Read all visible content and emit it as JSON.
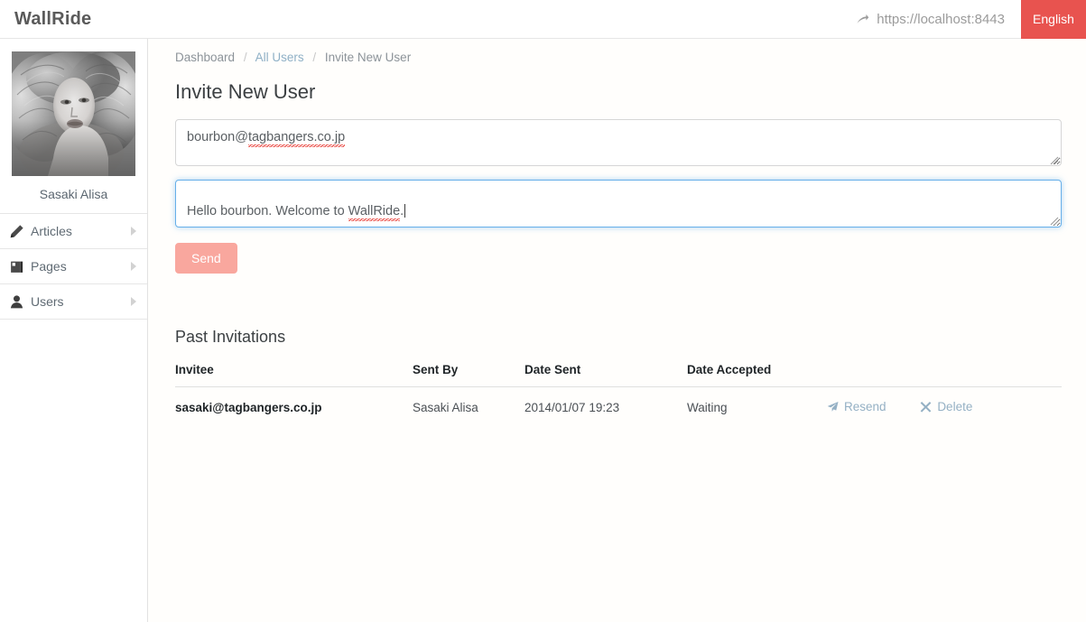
{
  "header": {
    "brand": "WallRide",
    "site_url": "https://localhost:8443",
    "site_url_icon": "share-arrow-icon",
    "language_label": "English",
    "language_bg": "#e8534f"
  },
  "sidebar": {
    "avatar_icon": "user-avatar-photo",
    "profile_name": "Sasaki Alisa",
    "items": [
      {
        "label": "Articles",
        "icon": "pencil-icon"
      },
      {
        "label": "Pages",
        "icon": "book-icon"
      },
      {
        "label": "Users",
        "icon": "person-icon"
      }
    ]
  },
  "main": {
    "breadcrumb": {
      "dashboard": "Dashboard",
      "all_users": "All Users",
      "current": "Invite New User",
      "separator": "/"
    },
    "page_title": "Invite New User",
    "form": {
      "email_value": "bourbon@tagbangers.co.jp",
      "email_misspelled": "tagbangers.co.jp",
      "email_prefix": "bourbon@",
      "message_prefix": "Hello bourbon. Welcome to ",
      "message_misspelled": "WallRide",
      "message_suffix": ".",
      "message_value": "Hello bourbon. Welcome to WallRide.",
      "send_label": "Send",
      "send_color": "#f9a79e"
    },
    "past_invitations": {
      "title": "Past Invitations",
      "columns": [
        "Invitee",
        "Sent By",
        "Date Sent",
        "Date Accepted",
        ""
      ],
      "rows": [
        {
          "invitee": "sasaki@tagbangers.co.jp",
          "sent_by": "Sasaki Alisa",
          "date_sent": "2014/01/07 19:23",
          "date_accepted": "Waiting",
          "resend_label": "Resend",
          "resend_icon": "paper-plane-icon",
          "delete_label": "Delete",
          "delete_icon": "times-icon"
        }
      ],
      "link_color": "#94b0c4"
    }
  }
}
